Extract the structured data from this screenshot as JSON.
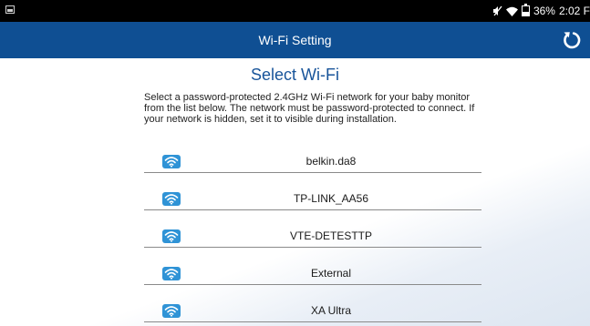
{
  "status_bar": {
    "battery_percent_label": "36%",
    "battery_level": 0.36,
    "time": "2:02 F"
  },
  "app_bar": {
    "title": "Wi-Fi Setting"
  },
  "main": {
    "heading": "Select Wi-Fi",
    "description": "Select a password-protected 2.4GHz Wi-Fi network for your baby monitor from the list below. The network must be password-protected to connect. If your network is hidden, set it to visible during installation."
  },
  "networks": [
    {
      "name": "belkin.da8",
      "icon": "wifi-icon"
    },
    {
      "name": "TP-LINK_AA56",
      "icon": "wifi-icon"
    },
    {
      "name": "VTE-DETESTTP",
      "icon": "wifi-icon"
    },
    {
      "name": "External",
      "icon": "wifi-icon"
    },
    {
      "name": "XA Ultra",
      "icon": "wifi-icon"
    }
  ],
  "colors": {
    "app_bar": "#0f4f93",
    "heading": "#18549a",
    "wifi_badge": "#2f93d6"
  }
}
